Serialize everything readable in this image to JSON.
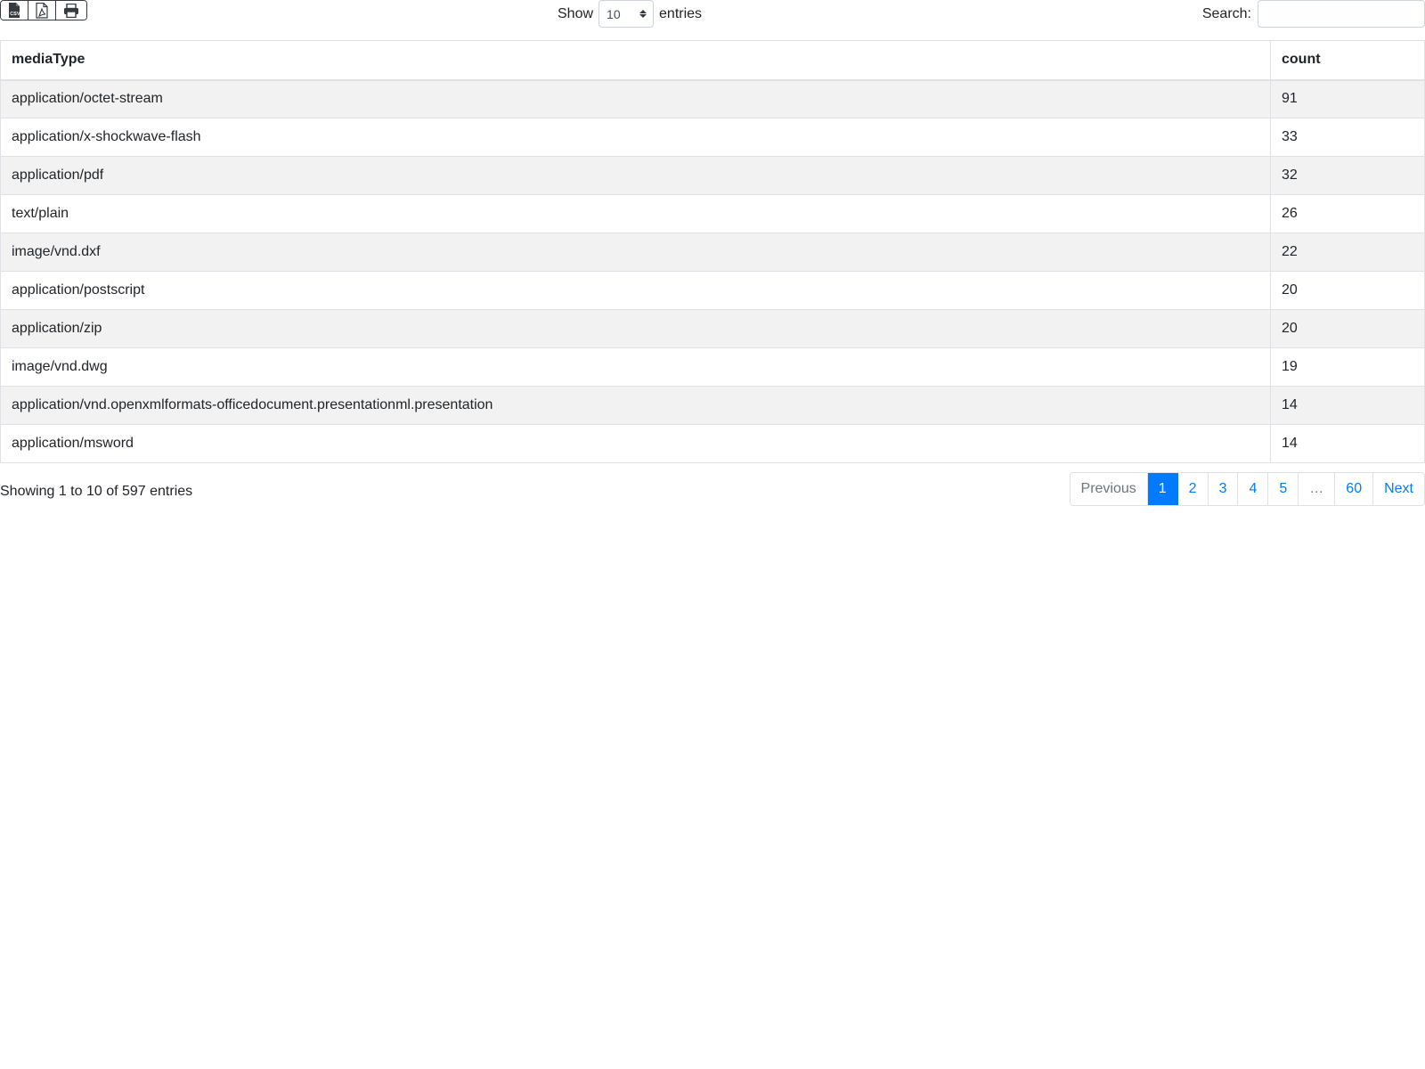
{
  "toolbar": {
    "buttons": [
      {
        "name": "csv-export",
        "icon": "csv-file-icon",
        "icon_text": "CSV"
      },
      {
        "name": "pdf-export",
        "icon": "pdf-file-icon"
      },
      {
        "name": "print",
        "icon": "print-icon"
      }
    ],
    "length": {
      "show_label": "Show",
      "selected": "10",
      "entries_label": "entries"
    },
    "search": {
      "label": "Search:",
      "value": "",
      "placeholder": ""
    }
  },
  "table": {
    "columns": [
      "mediaType",
      "count"
    ],
    "rows": [
      {
        "mediaType": "application/octet-stream",
        "count": "91"
      },
      {
        "mediaType": "application/x-shockwave-flash",
        "count": "33"
      },
      {
        "mediaType": "application/pdf",
        "count": "32"
      },
      {
        "mediaType": "text/plain",
        "count": "26"
      },
      {
        "mediaType": "image/vnd.dxf",
        "count": "22"
      },
      {
        "mediaType": "application/postscript",
        "count": "20"
      },
      {
        "mediaType": "application/zip",
        "count": "20"
      },
      {
        "mediaType": "image/vnd.dwg",
        "count": "19"
      },
      {
        "mediaType": "application/vnd.openxmlformats-officedocument.presentationml.presentation",
        "count": "14"
      },
      {
        "mediaType": "application/msword",
        "count": "14"
      }
    ]
  },
  "footer": {
    "info": "Showing 1 to 10 of 597 entries",
    "pagination": {
      "previous": "Previous",
      "pages": [
        "1",
        "2",
        "3",
        "4",
        "5"
      ],
      "ellipsis": "…",
      "last": "60",
      "next": "Next",
      "active": "1"
    }
  },
  "colors": {
    "accent": "#007bff",
    "stripe": "#f2f2f2",
    "border": "#dee2e6",
    "text": "#212529"
  }
}
